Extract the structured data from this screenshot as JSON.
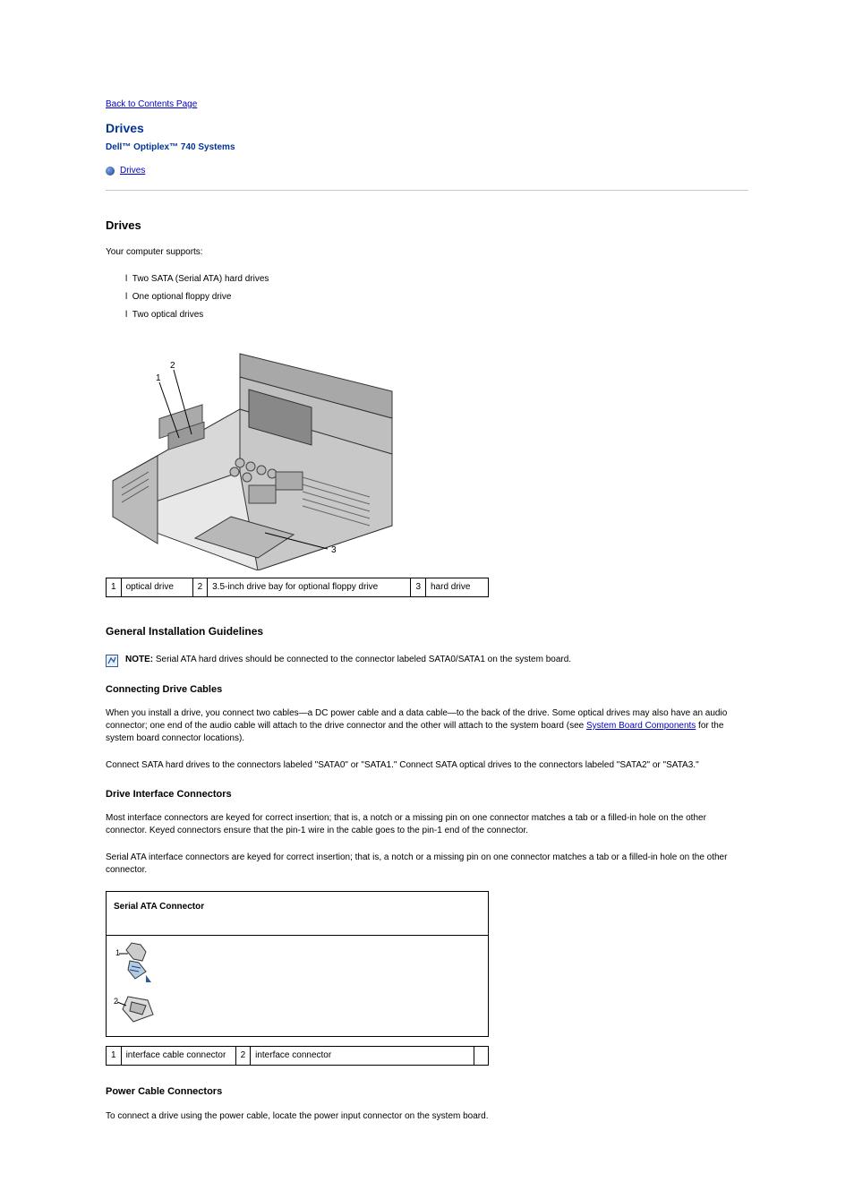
{
  "back_link": "Back to Contents Page",
  "page_title": "Drives",
  "subtitle": "Dell™ Optiplex™ 740 Systems",
  "toc_link": "Drives",
  "section_heading": "Drives",
  "intro": {
    "supports": "Your computer supports:",
    "b1": "Two SATA (Serial ATA) hard drives",
    "b2": "One optional floppy drive",
    "b3": "Two optical drives"
  },
  "fig1_labels": {
    "r1": {
      "n": "1",
      "t": "optical drive"
    },
    "r2": {
      "n": "2",
      "t": "3.5-inch drive bay for optional floppy drive"
    },
    "r3": {
      "n": "3",
      "t": "hard drive"
    }
  },
  "guidelines_heading": "General Installation Guidelines",
  "note": {
    "label": "NOTE:",
    "text": "Serial ATA hard drives should be connected to the connector labeled SATA0/SATA1 on the system board."
  },
  "connecting_heading": "Connecting Drive Cables",
  "connecting_text": {
    "p1_a": "When you install a drive, you connect two cables—a DC power cable and a data cable—to the back of the drive. Some optical drives may also have an audio connector; one end of the audio cable will attach to the drive connector and the other will attach to the system board (see ",
    "p1_link": "System Board Components",
    "p1_b": " for the system board connector locations).",
    "p2_a": "Connect SATA hard drives to the connectors labeled \"SATA0\" or \"SATA1.\" Connect ",
    "p2_b": "SATA optical drives to the connectors labeled \"SATA2\" or \"SATA3.\""
  },
  "interface_heading": "Drive Interface Connectors",
  "keyed": {
    "p1": "Most interface connectors are keyed for correct insertion; that is, a notch or a missing pin on one connector matches a tab or a filled-in hole on the other connector. Keyed connectors ensure that the pin-1 wire in the cable goes to the pin-1 end of the connector.",
    "p2": "Serial ATA interface connectors are keyed for correct insertion; that is, a notch or a missing pin on one connector matches a tab or a filled-in hole on the other connector."
  },
  "box_header": "Serial ATA Connector",
  "fig2_labels": {
    "r1": {
      "n": "1",
      "t": "interface cable connector"
    },
    "r2": {
      "n": "2",
      "t": "interface connector"
    }
  },
  "power_heading": "Power Cable Connectors",
  "power_text": "To connect a drive using the power cable, locate the power input connector on the system board."
}
